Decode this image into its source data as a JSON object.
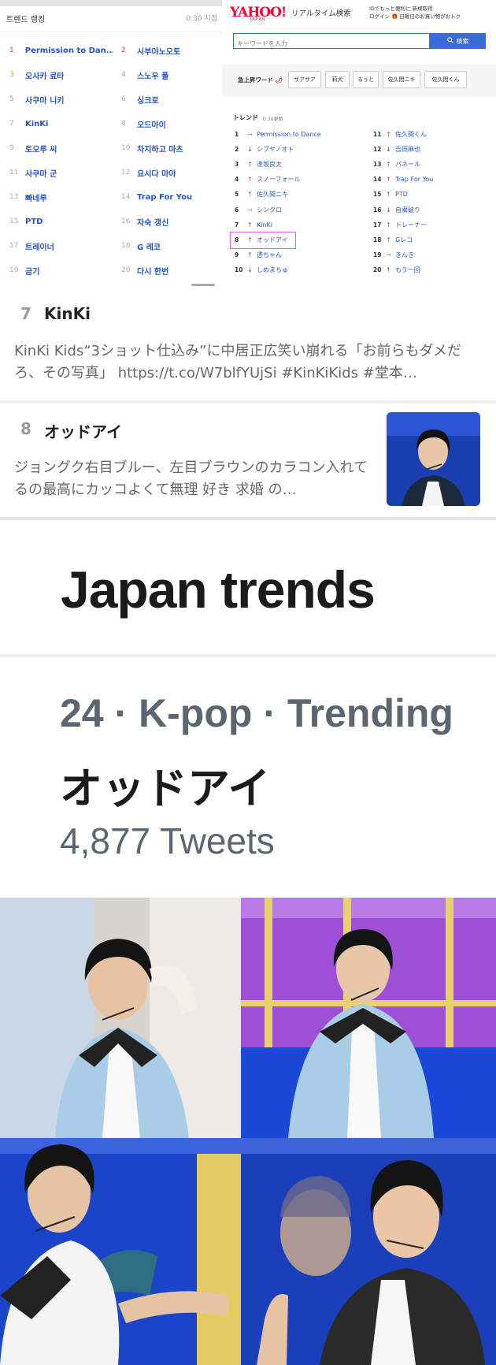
{
  "korean_ranking": {
    "title": "트렌드 랭킹",
    "time": "0:30 시점",
    "items": [
      {
        "num": "1",
        "label": "Permission to Dan..."
      },
      {
        "num": "2",
        "label": "시부야노오토"
      },
      {
        "num": "3",
        "label": "오사카 료타"
      },
      {
        "num": "4",
        "label": "스노우 폴"
      },
      {
        "num": "5",
        "label": "사쿠마 니키"
      },
      {
        "num": "6",
        "label": "싱크로"
      },
      {
        "num": "7",
        "label": "KinKi"
      },
      {
        "num": "8",
        "label": "오드아이"
      },
      {
        "num": "9",
        "label": "토오루 씨"
      },
      {
        "num": "10",
        "label": "차지하고 마츠"
      },
      {
        "num": "11",
        "label": "사쿠마 군"
      },
      {
        "num": "12",
        "label": "요시다 마야"
      },
      {
        "num": "13",
        "label": "빠네루"
      },
      {
        "num": "14",
        "label": "Trap For You"
      },
      {
        "num": "15",
        "label": "PTD"
      },
      {
        "num": "16",
        "label": "자숙 갱신"
      },
      {
        "num": "17",
        "label": "트레이너"
      },
      {
        "num": "18",
        "label": "G 레코"
      },
      {
        "num": "19",
        "label": "금기"
      },
      {
        "num": "20",
        "label": "다시 한번"
      }
    ]
  },
  "yahoo": {
    "logo": "YAHOO!",
    "logo_sub": "JAPAN",
    "title": "リアルタイム検索",
    "promo_line1": "IDでもっと便利に 新規取得",
    "promo_line2": "ログイン 🎁 日曜日のお買い物がおトク",
    "search_placeholder": "キーワードを入力",
    "search_button": "検索",
    "rising_label": "急上昇ワード",
    "rising_chips": [
      "ザアザア",
      "莉犬",
      "るぅと",
      "佐久間ニキ",
      "佐久間くん"
    ],
    "trend_label": "トレンド",
    "trend_time": "0:30更新",
    "trends_left": [
      {
        "n": "1",
        "dir": "flat",
        "text": "Permission to Dance"
      },
      {
        "n": "2",
        "dir": "down",
        "text": "シブヤノオト"
      },
      {
        "n": "3",
        "dir": "up",
        "text": "逢坂良太"
      },
      {
        "n": "4",
        "dir": "up",
        "text": "スノーフォール"
      },
      {
        "n": "5",
        "dir": "up",
        "text": "佐久間ニキ"
      },
      {
        "n": "6",
        "dir": "flat",
        "text": "シンクロ"
      },
      {
        "n": "7",
        "dir": "up",
        "text": "KinKi"
      },
      {
        "n": "8",
        "dir": "up",
        "text": "オッドアイ"
      },
      {
        "n": "9",
        "dir": "up",
        "text": "透ちゃん"
      },
      {
        "n": "10",
        "dir": "down",
        "text": "しめまちゅ"
      }
    ],
    "trends_right": [
      {
        "n": "11",
        "dir": "up",
        "text": "佐久間くん"
      },
      {
        "n": "12",
        "dir": "down",
        "text": "吉田麻也"
      },
      {
        "n": "13",
        "dir": "up",
        "text": "パネール"
      },
      {
        "n": "14",
        "dir": "up",
        "text": "Trap For You"
      },
      {
        "n": "15",
        "dir": "up",
        "text": "PTD"
      },
      {
        "n": "16",
        "dir": "down",
        "text": "自粛破り"
      },
      {
        "n": "17",
        "dir": "up",
        "text": "トレーナー"
      },
      {
        "n": "18",
        "dir": "up",
        "text": "Gレコ"
      },
      {
        "n": "19",
        "dir": "flat",
        "text": "きんき"
      },
      {
        "n": "20",
        "dir": "up",
        "text": "もう一回"
      }
    ]
  },
  "card7": {
    "num": "7",
    "name": "KinKi",
    "text": "KinKi Kids“3ショット仕込み”に中居正広笑い崩れる「お前らもダメだろ、その写真」 https://t.co/W7blfYUjSi #KinKiKids #堂本…"
  },
  "card8": {
    "num": "8",
    "name": "オッドアイ",
    "text": "ジョングク右目ブルー、左目ブラウンのカラコン入れてるの最高にカッコよくて無理 好き 求婚 の…"
  },
  "japan_trends": {
    "title": "Japan trends",
    "meta": "24 · K-pop · Trending",
    "name": "オッドアイ",
    "count": "4,877 Tweets"
  },
  "colors": {
    "accent_blue": "#2456c8",
    "yahoo_red": "#ff0033",
    "highlight_pink": "#e060e0"
  }
}
